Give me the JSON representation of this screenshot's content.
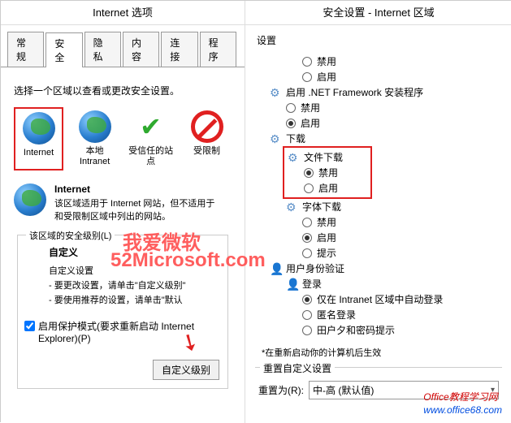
{
  "left": {
    "title": "Internet 选项",
    "tabs": [
      "常规",
      "安全",
      "隐私",
      "内容",
      "连接",
      "程序"
    ],
    "active_tab": 1,
    "desc": "选择一个区域以查看或更改安全设置。",
    "zones": [
      {
        "label": "Internet"
      },
      {
        "label": "本地 Intranet"
      },
      {
        "label": "受信任的站点"
      },
      {
        "label": "受限制"
      }
    ],
    "info": {
      "heading": "Internet",
      "body1": "该区域适用于 Internet 网站，但不适用于",
      "body2": "和受限制区域中列出的网站。"
    },
    "level_legend": "该区域的安全级别(L)",
    "custom_title": "自定义",
    "custom_sub": "自定义设置",
    "custom_b1": "要更改设置，请单击\"自定义级别\"",
    "custom_b2": "要使用推荐的设置，请单击\"默认",
    "protected": "启用保护模式(要求重新启动 Internet Explorer)(P)",
    "custom_btn": "自定义级别"
  },
  "right": {
    "title": "安全设置 - Internet 区域",
    "settings_label": "设置",
    "tree": {
      "disable": "禁用",
      "enable": "启用",
      "netfx": "启用 .NET Framework 安装程序",
      "download": "下载",
      "file_dl": "文件下载",
      "font_dl": "字体下载",
      "prompt": "提示",
      "auth": "用户身份验证",
      "login": "登录",
      "intranet_only": "仅在 Intranet 区域中自动登录",
      "anon": "匿名登录",
      "usecred": "田户夕和密码提示"
    },
    "note": "*在重新启动你的计算机后生效",
    "reset_legend": "重置自定义设置",
    "reset_label": "重置为(R):",
    "reset_value": "中-高 (默认值)"
  },
  "watermark1": "我爱微软",
  "watermark2": "52Microsoft.com",
  "wm3a": "Office教程学习网",
  "wm3b": "www.office68.com"
}
